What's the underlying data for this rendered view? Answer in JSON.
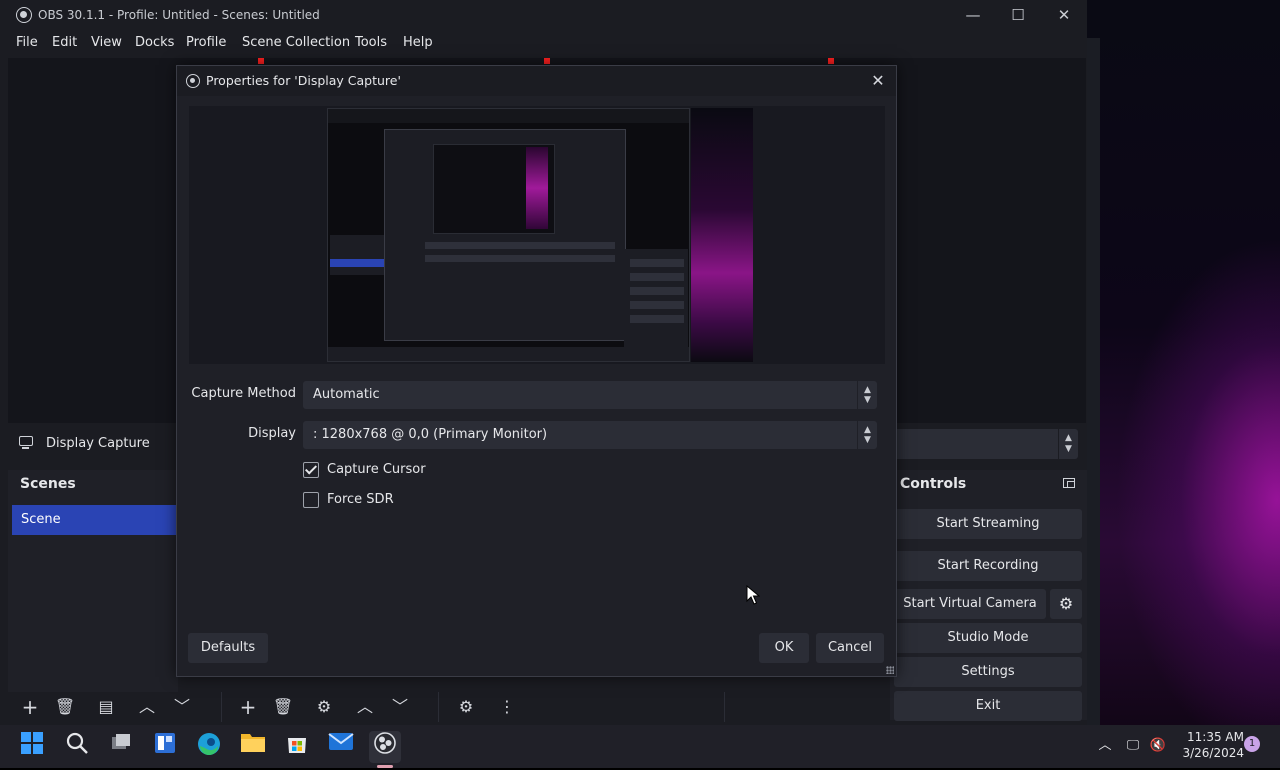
{
  "window": {
    "title": "OBS 30.1.1 - Profile: Untitled - Scenes: Untitled",
    "minimize_glyph": "—",
    "maximize_glyph": "☐",
    "close_glyph": "✕"
  },
  "menu": [
    "File",
    "Edit",
    "View",
    "Docks",
    "Profile",
    "Scene Collection",
    "Tools",
    "Help"
  ],
  "source_bar": {
    "label": "Display Capture"
  },
  "scenes_dock": {
    "title": "Scenes",
    "items": [
      "Scene"
    ]
  },
  "controls_dock": {
    "title": "Controls",
    "buttons": {
      "start_streaming": "Start Streaming",
      "start_recording": "Start Recording",
      "start_virtual_camera": "Start Virtual Camera",
      "studio_mode": "Studio Mode",
      "settings": "Settings",
      "exit": "Exit"
    }
  },
  "dialog": {
    "title": "Properties for 'Display Capture'",
    "capture_method_label": "Capture Method",
    "capture_method_value": "Automatic",
    "display_label": "Display",
    "display_value": ": 1280x768 @ 0,0 (Primary Monitor)",
    "capture_cursor_label": "Capture Cursor",
    "capture_cursor_checked": true,
    "force_sdr_label": "Force SDR",
    "force_sdr_checked": false,
    "defaults_button": "Defaults",
    "ok_button": "OK",
    "cancel_button": "Cancel"
  },
  "taskbar": {
    "time": "11:35 AM",
    "date": "3/26/2024",
    "notification_count": "1"
  },
  "colors": {
    "accent_selection": "#2a44b4",
    "panel_bg": "#1f2027",
    "button_bg": "#2b2d36",
    "preview_marker": "#ff2020"
  }
}
